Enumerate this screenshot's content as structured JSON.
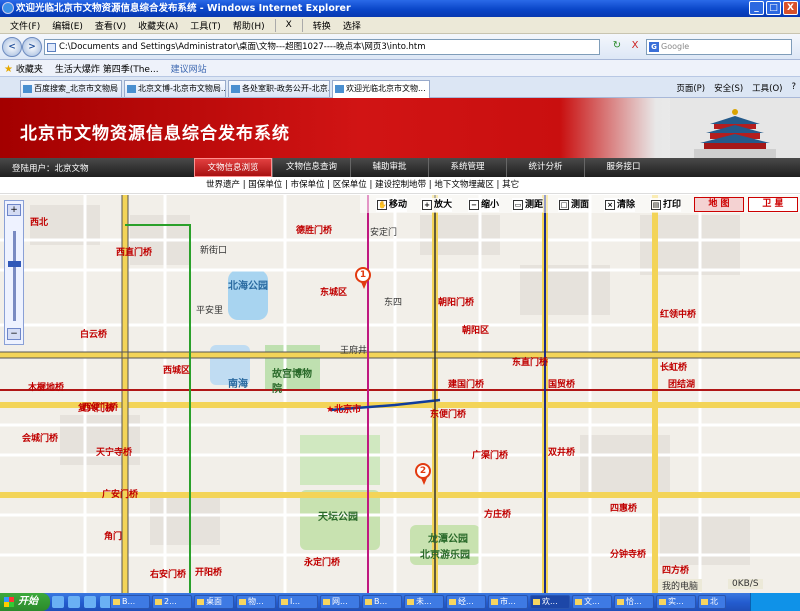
{
  "window": {
    "title": "欢迎光临北京市文物资源信息综合发布系统 - Windows Internet Explorer",
    "minimize": "_",
    "maximize": "□",
    "close": "X"
  },
  "menu": {
    "items": [
      "文件(F)",
      "编辑(E)",
      "查看(V)",
      "收藏夹(A)",
      "工具(T)",
      "帮助(H)"
    ],
    "close_x": "X",
    "convert": "转换",
    "select": "选择"
  },
  "address": {
    "back": "<",
    "forward": ">",
    "url": "C:\\Documents and Settings\\Administrator\\桌面\\文物---超图1027----晚点本\\网页3\\into.htm",
    "refresh_icon": "↻",
    "stop_icon": "X",
    "search_placeholder": "Google"
  },
  "favorites": {
    "label": "收藏夹",
    "item1": "生活大爆炸 第四季(The...",
    "item2": "建议网站"
  },
  "tabs": [
    {
      "label": "百度搜索_北京市文物局"
    },
    {
      "label": "北京文博-北京市文物局..."
    },
    {
      "label": "各处室职-政务公开-北京..."
    },
    {
      "label": "欢迎光临北京市文物..."
    }
  ],
  "toolbar_right": {
    "page": "页面(P)",
    "safety": "安全(S)",
    "tools": "工具(O)",
    "help": "?"
  },
  "banner": {
    "title": "北京市文物资源信息综合发布系统"
  },
  "nav": {
    "login": "登陆用户：北京文物",
    "items": [
      "文物信息浏览",
      "文物信息查询",
      "辅助审批",
      "系统管理",
      "统计分析",
      "服务接口"
    ]
  },
  "subnav": {
    "text": "世界遗产 | 国保单位 | 市保单位 | 区保单位 | 建设控制地带 | 地下文物埋藏区 | 其它"
  },
  "map_tools": {
    "move": "移动",
    "zoom_in": "放大",
    "zoom_out": "缩小",
    "measure_distance": "测距",
    "measure_area": "测面",
    "clear": "清除",
    "print": "打印",
    "mode_map": "地 图",
    "mode_satellite": "卫 星"
  },
  "map_labels": {
    "dongcheng": "东城区",
    "xicheng": "西城区",
    "chaoyang": "朝阳区",
    "beijing": "★北京市",
    "beihai": "北海公园",
    "gugong": "故宫博物院",
    "nanhai": "南海",
    "tiantan": "天坛公园",
    "longtan": "龙潭公园",
    "youle": "北京游乐园",
    "guangqumen": "广渠门桥",
    "shuangjing": "双井桥",
    "guomao": "国贸桥",
    "jianguomen": "建国门桥",
    "fuxingmen": "复兴门桥",
    "xizhimen": "西直门桥",
    "tianning": "天宁寺桥",
    "guanganmen": "广安门桥",
    "taoranting": "陶然亭",
    "sihui": "四惠桥",
    "hongling": "红领中桥",
    "dongzhimen": "东直门桥",
    "changhong": "长虹桥",
    "tuanjiehu": "团结湖",
    "fenzhongsi": "分钟寺桥",
    "sifang": "四方桥",
    "yongdingmen": "永定门桥",
    "youanmen": "右安门桥",
    "kaiyang": "开阳桥",
    "muxidi": "木樨地桥",
    "huilonghu": "会城门桥",
    "baiyun": "白云桥",
    "dongbianmen": "东便门桥",
    "xibianmen": "西便门桥",
    "jiaomen": "角门",
    "fangzhuang": "方庄桥",
    "xibei": "西北",
    "dongsi": "东四",
    "wangfujing": "王府井",
    "chaoyangmen": "朝阳门桥",
    "andingmen": "安定门",
    "xinjiekou": "新街口",
    "pinganli": "平安里",
    "deshengmen": "德胜门桥"
  },
  "pins": {
    "p1": "1",
    "p2": "2"
  },
  "status": {
    "computer": "我的电脑",
    "speed": "0KB/S"
  },
  "taskbar": {
    "start": "开始",
    "items": [
      "B...",
      "2...",
      "桌面",
      "物...",
      "I...",
      "网...",
      "B...",
      "未...",
      "经...",
      "市...",
      "欢...",
      "文...",
      "恰...",
      "实...",
      "北",
      "未..."
    ]
  }
}
